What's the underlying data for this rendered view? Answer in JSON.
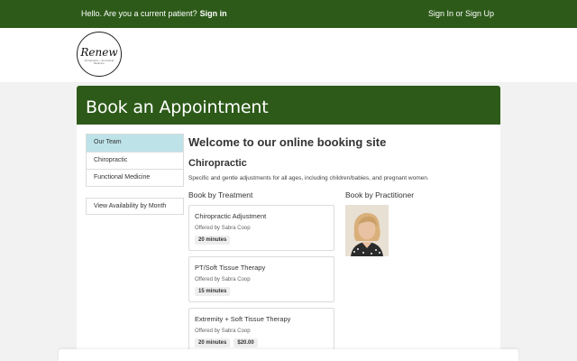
{
  "topbar": {
    "greeting": "Hello. Are you a current patient?",
    "sign_in": "Sign in",
    "sign_in_up": "Sign In or Sign Up"
  },
  "logo": {
    "name": "Renew",
    "tagline": "Chiropractic + Functional Medicine"
  },
  "card": {
    "title": "Book an Appointment"
  },
  "sidebar": {
    "items": [
      {
        "label": "Our Team",
        "active": true
      },
      {
        "label": "Chiropractic",
        "active": false
      },
      {
        "label": "Functional Medicine",
        "active": false
      }
    ],
    "availability": "View Availability by Month"
  },
  "main": {
    "welcome": "Welcome to our online booking site",
    "section": "Chiropractic",
    "description": "Specific and gentle adjustments for all ages, including children/babies, and pregnant women.",
    "by_treatment": "Book by Treatment",
    "by_practitioner": "Book by Practitioner",
    "services": [
      {
        "name": "Chiropractic Adjustment",
        "offered_by": "Offered by Sabra Coop",
        "duration": "20 minutes"
      },
      {
        "name": "PT/Soft Tissue Therapy",
        "offered_by": "Offered by Sabra Coop",
        "duration": "15 minutes"
      },
      {
        "name": "Extremity + Soft Tissue Therapy",
        "offered_by": "Offered by Sabra Coop",
        "duration": "20 minutes",
        "price": "$20.00"
      }
    ]
  },
  "colors": {
    "brand_green": "#2d5a19",
    "active_nav": "#bde3e8"
  }
}
